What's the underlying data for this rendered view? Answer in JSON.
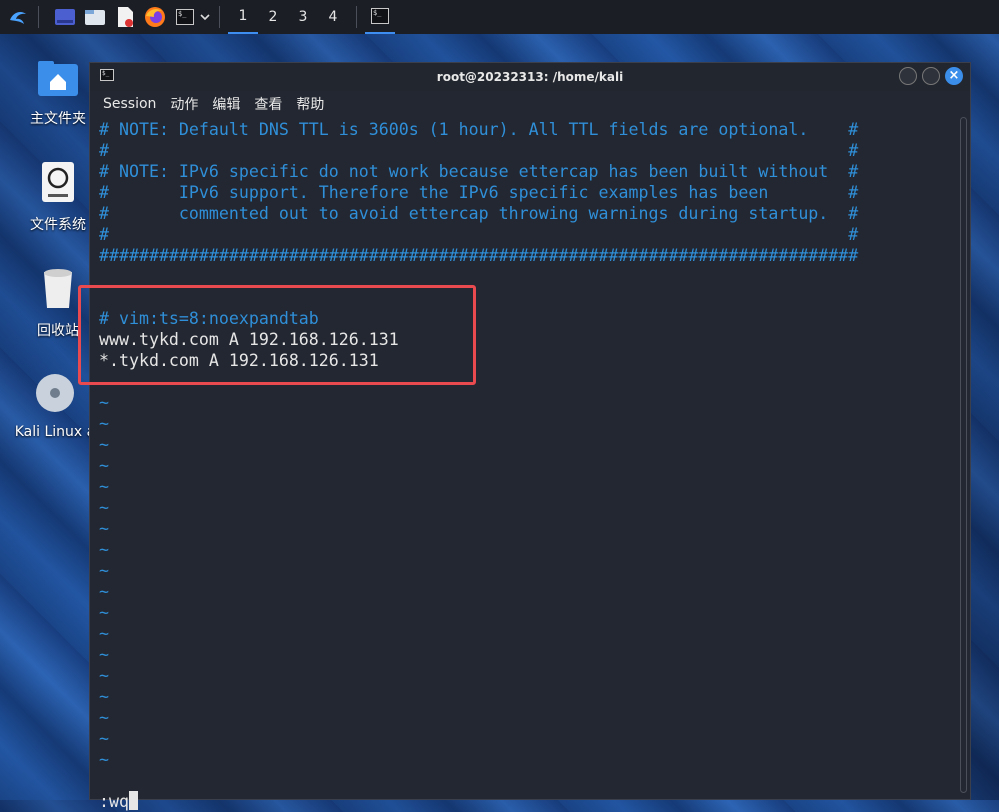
{
  "taskbar": {
    "icons": [
      "kali-menu-icon",
      "desktop-icon",
      "file-manager-icon",
      "text-editor-icon",
      "firefox-icon",
      "terminal-icon"
    ],
    "workspaces": [
      "1",
      "2",
      "3",
      "4"
    ],
    "active_workspace": "1"
  },
  "desktop": {
    "icons": [
      {
        "name": "home-folder",
        "label": "主文件夹"
      },
      {
        "name": "file-system",
        "label": "文件系统"
      },
      {
        "name": "trash",
        "label": "回收站"
      },
      {
        "name": "kali-linux",
        "label": "Kali Linux a"
      }
    ]
  },
  "window": {
    "title": "root@20232313: /home/kali",
    "menu": [
      "Session",
      "动作",
      "编辑",
      "查看",
      "帮助"
    ]
  },
  "terminal": {
    "lines": [
      "# NOTE: Default DNS TTL is 3600s (1 hour). All TTL fields are optional.    #",
      "#                                                                          #",
      "# NOTE: IPv6 specific do not work because ettercap has been built without  #",
      "#       IPv6 support. Therefore the IPv6 specific examples has been        #",
      "#       commented out to avoid ettercap throwing warnings during startup.  #",
      "#                                                                          #",
      "############################################################################",
      "",
      "",
      "# vim:ts=8:noexpandtab",
      "www.tykd.com A 192.168.126.131",
      "*.tykd.com A 192.168.126.131",
      "",
      "~",
      "~",
      "~",
      "~",
      "~",
      "~",
      "~",
      "~",
      "~",
      "~",
      "~",
      "~",
      "~",
      "~",
      "~",
      "~",
      "~",
      "~",
      "",
      ":wq"
    ],
    "comment_lines": [
      0,
      1,
      2,
      3,
      4,
      5,
      6,
      9
    ],
    "command": ":wq"
  },
  "colors": {
    "comment": "#2f8fd8",
    "highlight_box": "#e84a4f",
    "close_button": "#3b8eea"
  }
}
